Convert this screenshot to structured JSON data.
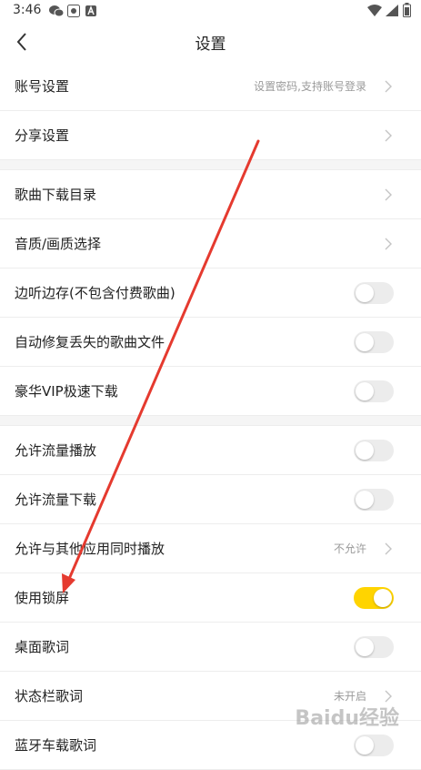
{
  "status_bar": {
    "time": "3:46"
  },
  "header": {
    "title": "设置"
  },
  "rows": {
    "account": {
      "label": "账号设置",
      "value": "设置密码,支持账号登录"
    },
    "share": {
      "label": "分享设置"
    },
    "download_dir": {
      "label": "歌曲下载目录"
    },
    "quality": {
      "label": "音质/画质选择"
    },
    "listen_save": {
      "label": "边听边存(不包含付费歌曲)",
      "state": "off"
    },
    "auto_repair": {
      "label": "自动修复丢失的歌曲文件",
      "state": "off"
    },
    "vip_download": {
      "label": "豪华VIP极速下载",
      "state": "off"
    },
    "data_play": {
      "label": "允许流量播放",
      "state": "off"
    },
    "data_download": {
      "label": "允许流量下载",
      "state": "off"
    },
    "other_apps": {
      "label": "允许与其他应用同时播放",
      "value": "不允许"
    },
    "lock_screen": {
      "label": "使用锁屏",
      "state": "on"
    },
    "desktop_lyrics": {
      "label": "桌面歌词",
      "state": "off"
    },
    "statusbar_lyrics": {
      "label": "状态栏歌词",
      "value": "未开启"
    },
    "car_lyrics": {
      "label": "蓝牙车载歌词",
      "state": "off"
    }
  },
  "watermark": {
    "text": "Baidu经验"
  },
  "colors": {
    "accent": "#ffd400",
    "annotation_arrow": "#e53a2f"
  }
}
